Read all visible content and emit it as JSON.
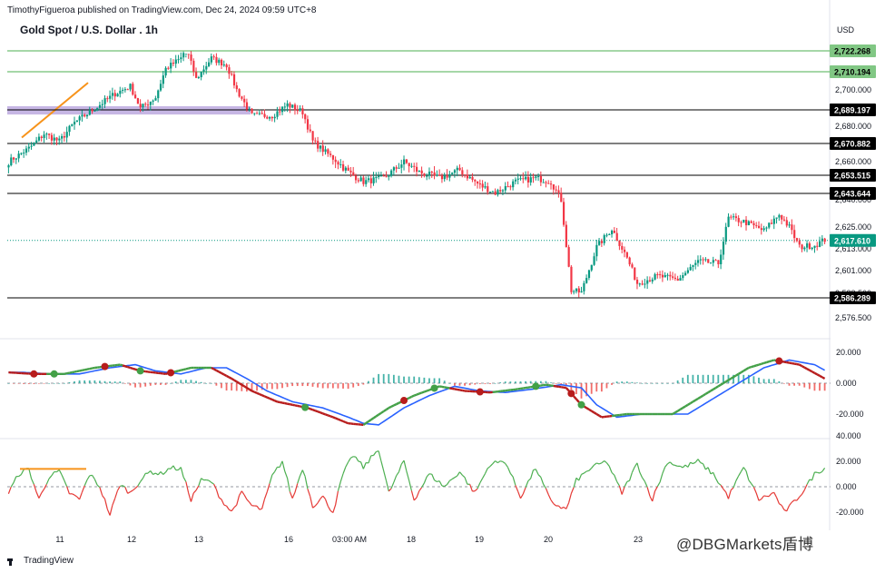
{
  "header": {
    "publisher": "TimothyFigueroa published on TradingView.com, Dec 24, 2024 09:59 UTC+8",
    "symbol": "Gold Spot / U.S. Dollar . 1h",
    "currency": "USD"
  },
  "brand": {
    "name": "TradingView",
    "watermark": "@DBGMarkets盾博"
  },
  "chart_data": {
    "type": "candlestick",
    "price_axis": {
      "ticks": [
        "2,700.000",
        "2,680.000",
        "2,660.000",
        "2,640.000",
        "2,625.000",
        "2,613.000",
        "2,601.000",
        "2,588.500",
        "2,576.500"
      ]
    },
    "levels": [
      {
        "label": "2,722.268",
        "value": 2722.268,
        "color": "#4caf50",
        "style": "green"
      },
      {
        "label": "2,710.194",
        "value": 2710.194,
        "color": "#4caf50",
        "style": "green"
      },
      {
        "label": "2,689.197",
        "value": 2689.197,
        "color": "#000000",
        "style": "black"
      },
      {
        "label": "2,670.882",
        "value": 2670.882,
        "color": "#000000",
        "style": "black"
      },
      {
        "label": "2,653.515",
        "value": 2653.515,
        "color": "#000000",
        "style": "black"
      },
      {
        "label": "2,643.644",
        "value": 2643.644,
        "color": "#000000",
        "style": "black"
      },
      {
        "label": "2,586.289",
        "value": 2586.289,
        "color": "#000000",
        "style": "black"
      }
    ],
    "last_price": {
      "label": "2,617.610",
      "value": 2617.61,
      "color": "#089981"
    },
    "x_labels": [
      "11",
      "12",
      "13",
      "16",
      "03:00 AM",
      "18",
      "19",
      "20",
      "23"
    ],
    "macd_axis": [
      "20.000",
      "0.000",
      "-20.000"
    ],
    "osc_axis": [
      "40.000",
      "20.000",
      "0.000",
      "-20.000"
    ],
    "colors": {
      "up": "#089981",
      "down": "#f23645",
      "macd_signal_red": "#b71c1c",
      "macd_line_blue": "#2962ff",
      "macd_line_green": "#43a047",
      "hist_up": "#26a69a",
      "hist_down": "#ef5350",
      "trend": "#f7931a",
      "zone": "#b39ddb"
    },
    "price_anchors": [
      [
        0,
        2660
      ],
      [
        8,
        2668
      ],
      [
        14,
        2676
      ],
      [
        20,
        2672
      ],
      [
        26,
        2682
      ],
      [
        34,
        2690
      ],
      [
        42,
        2698
      ],
      [
        48,
        2702
      ],
      [
        52,
        2690
      ],
      [
        58,
        2696
      ],
      [
        62,
        2712
      ],
      [
        68,
        2718
      ],
      [
        70,
        2724
      ],
      [
        74,
        2706
      ],
      [
        80,
        2718
      ],
      [
        86,
        2714
      ],
      [
        90,
        2700
      ],
      [
        96,
        2686
      ],
      [
        104,
        2686
      ],
      [
        110,
        2692
      ],
      [
        116,
        2688
      ],
      [
        120,
        2672
      ],
      [
        128,
        2662
      ],
      [
        134,
        2655
      ],
      [
        140,
        2650
      ],
      [
        148,
        2652
      ],
      [
        156,
        2660
      ],
      [
        162,
        2655
      ],
      [
        170,
        2652
      ],
      [
        178,
        2656
      ],
      [
        186,
        2648
      ],
      [
        192,
        2644
      ],
      [
        200,
        2650
      ],
      [
        208,
        2652
      ],
      [
        214,
        2650
      ],
      [
        218,
        2640
      ],
      [
        222,
        2590
      ],
      [
        226,
        2589
      ],
      [
        232,
        2614
      ],
      [
        238,
        2624
      ],
      [
        244,
        2608
      ],
      [
        248,
        2594
      ],
      [
        256,
        2598
      ],
      [
        264,
        2596
      ],
      [
        272,
        2606
      ],
      [
        280,
        2605
      ],
      [
        284,
        2630
      ],
      [
        290,
        2628
      ],
      [
        298,
        2623
      ],
      [
        304,
        2632
      ],
      [
        308,
        2625
      ],
      [
        312,
        2614
      ],
      [
        318,
        2615
      ],
      [
        322,
        2618
      ]
    ],
    "macd_anchors": [
      [
        0,
        7
      ],
      [
        10,
        6
      ],
      [
        22,
        6
      ],
      [
        34,
        10
      ],
      [
        44,
        12
      ],
      [
        52,
        8
      ],
      [
        62,
        6
      ],
      [
        72,
        10
      ],
      [
        80,
        10
      ],
      [
        88,
        3
      ],
      [
        96,
        -5
      ],
      [
        106,
        -12
      ],
      [
        118,
        -16
      ],
      [
        128,
        -22
      ],
      [
        134,
        -26
      ],
      [
        140,
        -27
      ],
      [
        150,
        -16
      ],
      [
        160,
        -8
      ],
      [
        170,
        -2
      ],
      [
        180,
        -5
      ],
      [
        190,
        -6
      ],
      [
        200,
        -4
      ],
      [
        212,
        -1
      ],
      [
        220,
        -3
      ],
      [
        226,
        -14
      ],
      [
        234,
        -22
      ],
      [
        244,
        -20
      ],
      [
        254,
        -20
      ],
      [
        262,
        -20
      ],
      [
        272,
        -10
      ],
      [
        282,
        0
      ],
      [
        292,
        10
      ],
      [
        302,
        15
      ],
      [
        312,
        12
      ],
      [
        322,
        3
      ]
    ],
    "osc_anchors": [
      [
        0,
        -5
      ],
      [
        4,
        10
      ],
      [
        8,
        14
      ],
      [
        12,
        -10
      ],
      [
        16,
        8
      ],
      [
        20,
        12
      ],
      [
        24,
        -5
      ],
      [
        28,
        -10
      ],
      [
        32,
        10
      ],
      [
        36,
        0
      ],
      [
        40,
        -22
      ],
      [
        44,
        2
      ],
      [
        48,
        -5
      ],
      [
        52,
        5
      ],
      [
        56,
        12
      ],
      [
        60,
        10
      ],
      [
        64,
        15
      ],
      [
        68,
        14
      ],
      [
        72,
        -10
      ],
      [
        76,
        5
      ],
      [
        80,
        4
      ],
      [
        84,
        -10
      ],
      [
        88,
        -20
      ],
      [
        92,
        -5
      ],
      [
        96,
        -15
      ],
      [
        100,
        -18
      ],
      [
        104,
        8
      ],
      [
        108,
        20
      ],
      [
        112,
        -10
      ],
      [
        116,
        15
      ],
      [
        120,
        -15
      ],
      [
        124,
        -8
      ],
      [
        128,
        -20
      ],
      [
        132,
        10
      ],
      [
        136,
        25
      ],
      [
        140,
        15
      ],
      [
        146,
        30
      ],
      [
        150,
        -5
      ],
      [
        156,
        20
      ],
      [
        160,
        -10
      ],
      [
        166,
        10
      ],
      [
        172,
        0
      ],
      [
        178,
        12
      ],
      [
        184,
        -5
      ],
      [
        190,
        18
      ],
      [
        196,
        20
      ],
      [
        202,
        -8
      ],
      [
        208,
        15
      ],
      [
        214,
        -12
      ],
      [
        220,
        -18
      ],
      [
        224,
        5
      ],
      [
        230,
        15
      ],
      [
        236,
        20
      ],
      [
        242,
        -5
      ],
      [
        248,
        18
      ],
      [
        254,
        -10
      ],
      [
        260,
        20
      ],
      [
        266,
        15
      ],
      [
        272,
        20
      ],
      [
        278,
        10
      ],
      [
        284,
        -8
      ],
      [
        290,
        15
      ],
      [
        296,
        -10
      ],
      [
        302,
        -5
      ],
      [
        306,
        -20
      ],
      [
        310,
        -12
      ],
      [
        314,
        -2
      ],
      [
        318,
        10
      ],
      [
        322,
        15
      ]
    ]
  }
}
